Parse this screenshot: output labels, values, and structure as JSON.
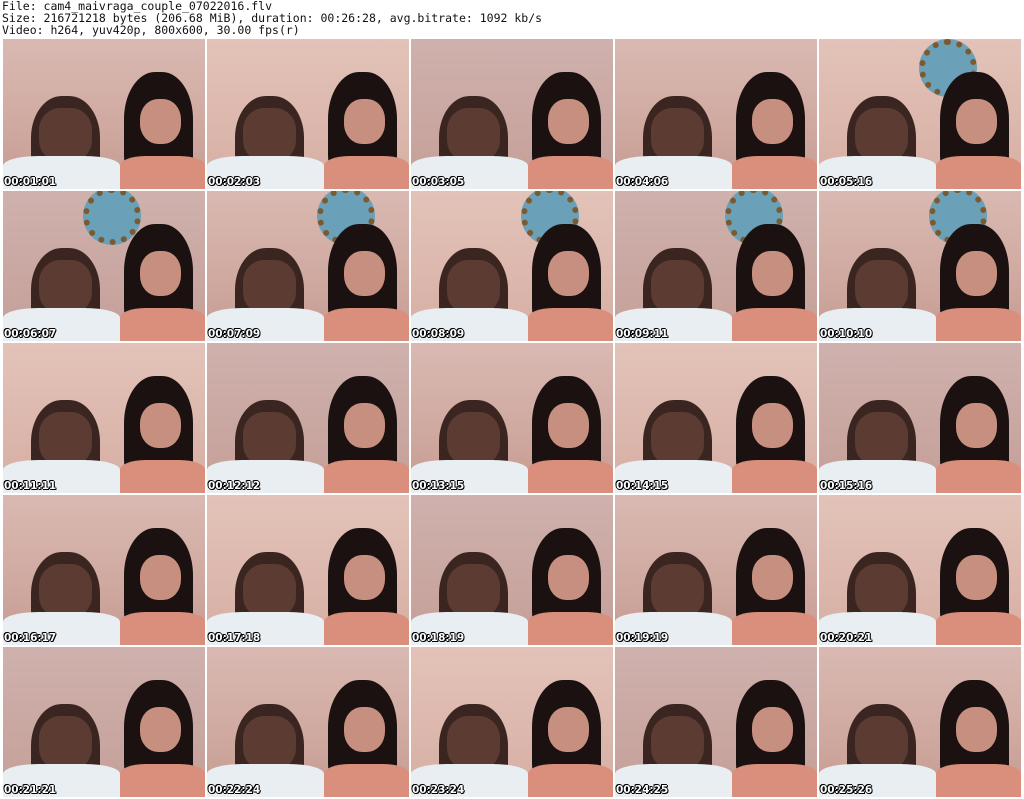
{
  "header": {
    "line1": "File: cam4_maivraga_couple_07022016.flv",
    "line2": "Size: 216721218 bytes (206.68 MiB), duration: 00:26:28, avg.bitrate: 1092 kb/s",
    "line3": "Video: h264, yuv420p, 800x600, 30.00 fps(r)"
  },
  "thumbnails": [
    {
      "timestamp": "00:01:01"
    },
    {
      "timestamp": "00:02:03"
    },
    {
      "timestamp": "00:03:05"
    },
    {
      "timestamp": "00:04:06"
    },
    {
      "timestamp": "00:05:16"
    },
    {
      "timestamp": "00:06:07"
    },
    {
      "timestamp": "00:07:09"
    },
    {
      "timestamp": "00:08:09"
    },
    {
      "timestamp": "00:09:11"
    },
    {
      "timestamp": "00:10:10"
    },
    {
      "timestamp": "00:11:11"
    },
    {
      "timestamp": "00:12:12"
    },
    {
      "timestamp": "00:13:15"
    },
    {
      "timestamp": "00:14:15"
    },
    {
      "timestamp": "00:15:16"
    },
    {
      "timestamp": "00:16:17"
    },
    {
      "timestamp": "00:17:18"
    },
    {
      "timestamp": "00:18:19"
    },
    {
      "timestamp": "00:19:19"
    },
    {
      "timestamp": "00:20:21"
    },
    {
      "timestamp": "00:21:21"
    },
    {
      "timestamp": "00:22:24"
    },
    {
      "timestamp": "00:23:24"
    },
    {
      "timestamp": "00:24:25"
    },
    {
      "timestamp": "00:25:26"
    }
  ]
}
